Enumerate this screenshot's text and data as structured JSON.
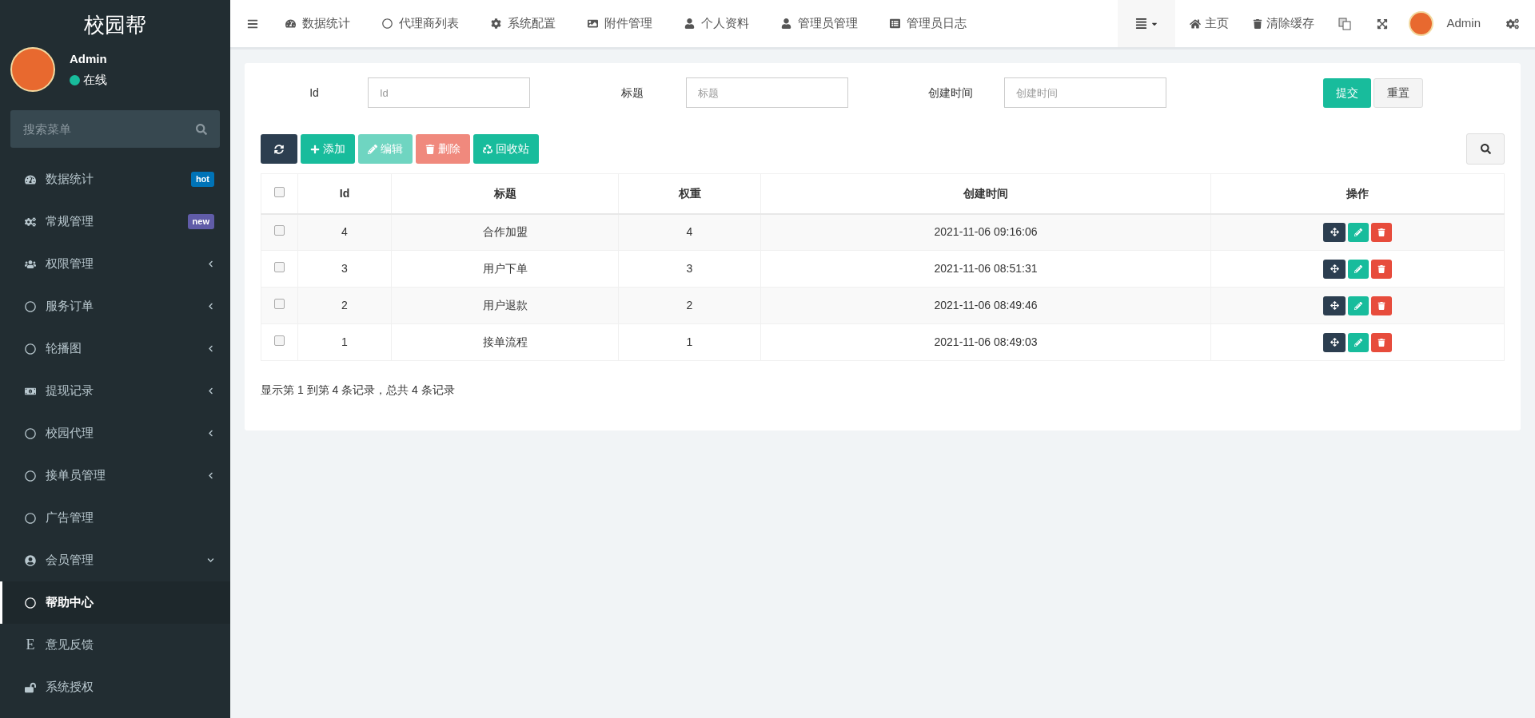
{
  "brand": "校园帮",
  "user": {
    "name": "Admin",
    "status": "在线"
  },
  "sidebar": {
    "search": {
      "placeholder": "搜索菜单"
    },
    "items": [
      {
        "label": "数据统计",
        "selected": false,
        "badge": {
          "text": "hot",
          "color": "#0073b7"
        }
      },
      {
        "label": "常规管理",
        "selected": false,
        "badge": {
          "text": "new",
          "color": "#605ca8"
        }
      },
      {
        "label": "权限管理",
        "selected": false,
        "expanded": false
      },
      {
        "label": "服务订单",
        "selected": false,
        "expanded": false
      },
      {
        "label": "轮播图",
        "selected": false,
        "expanded": false
      },
      {
        "label": "提现记录",
        "selected": false,
        "expanded": false
      },
      {
        "label": "校园代理",
        "selected": false,
        "expanded": false
      },
      {
        "label": "接单员管理",
        "selected": false,
        "expanded": false
      },
      {
        "label": "广告管理",
        "selected": false
      },
      {
        "label": "会员管理",
        "selected": false,
        "expanded": true
      },
      {
        "label": "帮助中心",
        "selected": true
      },
      {
        "label": "意见反馈",
        "selected": false,
        "glyph": "E"
      },
      {
        "label": "系统授权",
        "selected": false
      }
    ]
  },
  "topbar": {
    "tabs": [
      {
        "label": "数据统计"
      },
      {
        "label": "代理商列表"
      },
      {
        "label": "系统配置"
      },
      {
        "label": "附件管理"
      },
      {
        "label": "个人资料"
      },
      {
        "label": "管理员管理"
      },
      {
        "label": "管理员日志"
      }
    ],
    "links": [
      {
        "label": "主页"
      },
      {
        "label": "清除缓存"
      }
    ],
    "user": "Admin"
  },
  "filters": [
    {
      "label": "Id",
      "placeholder": "Id"
    },
    {
      "label": "标题",
      "placeholder": "标题"
    },
    {
      "label": "创建时间",
      "placeholder": "创建时间"
    }
  ],
  "filter_buttons": [
    {
      "label": "提交",
      "kind": "primary"
    },
    {
      "label": "重置",
      "kind": "default"
    }
  ],
  "toolbar": [
    {
      "label": "添加",
      "kind": "add",
      "disabled": false
    },
    {
      "label": "编辑",
      "kind": "edit",
      "disabled": true
    },
    {
      "label": "删除",
      "kind": "delete",
      "disabled": true
    },
    {
      "label": "回收站",
      "kind": "recycle",
      "disabled": false
    }
  ],
  "table": {
    "columns": [
      "Id",
      "标题",
      "权重",
      "创建时间",
      "操作"
    ],
    "rows": [
      {
        "checked": false,
        "cells": [
          "4",
          "合作加盟",
          "4",
          "2021-11-06 09:16:06"
        ]
      },
      {
        "checked": false,
        "cells": [
          "3",
          "用户下单",
          "3",
          "2021-11-06 08:51:31"
        ]
      },
      {
        "checked": false,
        "cells": [
          "2",
          "用户退款",
          "2",
          "2021-11-06 08:49:46"
        ]
      },
      {
        "checked": false,
        "cells": [
          "1",
          "接单流程",
          "1",
          "2021-11-06 08:49:03"
        ]
      }
    ],
    "header_checked": false
  },
  "footer": "显示第 1 到第 4 条记录，总共 4 条记录"
}
